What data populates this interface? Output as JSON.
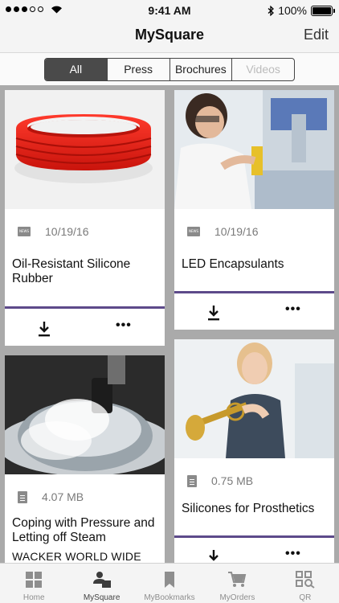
{
  "status_bar": {
    "time": "9:41 AM",
    "battery_percent": "100%",
    "battery_level": 1.0,
    "signal_bars_filled": 3,
    "signal_bars_total": 5
  },
  "nav": {
    "title": "MySquare",
    "edit_label": "Edit"
  },
  "filters": [
    {
      "label": "All",
      "state": "selected"
    },
    {
      "label": "Press",
      "state": "normal"
    },
    {
      "label": "Brochures",
      "state": "normal"
    },
    {
      "label": "Videos",
      "state": "disabled"
    }
  ],
  "cards": [
    {
      "badge": "NEWS",
      "meta": "10/19/16",
      "title": "Oil-Resistant Silicone Rubber",
      "image": "red silicone ring"
    },
    {
      "badge": "NEWS",
      "meta": "10/19/16",
      "title": "LED Encapsulants",
      "image": "lab technician dispensing encapsulant"
    },
    {
      "meta": "4.07 MB",
      "title": "Coping with Pressure and Letting off Steam",
      "subtitle": "WACKER WORLD WIDE",
      "image": "pressure cooker releasing steam"
    },
    {
      "meta": "0.75 MB",
      "title": "Silicones for Prosthetics",
      "image": "woman holding trumpet"
    }
  ],
  "icons": {
    "download": "download-icon",
    "more": "more-icon",
    "news": "news-icon",
    "document": "document-icon"
  },
  "tabs": [
    {
      "label": "Home",
      "icon": "grid-icon",
      "active": false
    },
    {
      "label": "MySquare",
      "icon": "person-square-icon",
      "active": true
    },
    {
      "label": "MyBookmarks",
      "icon": "bookmark-icon",
      "active": false
    },
    {
      "label": "MyOrders",
      "icon": "cart-icon",
      "active": false
    },
    {
      "label": "QR",
      "icon": "qr-icon",
      "active": false
    }
  ],
  "colors": {
    "accent_purple": "#5d4a8a",
    "segment_active": "#4a4a4a",
    "grid_background": "#aaaaaa"
  }
}
